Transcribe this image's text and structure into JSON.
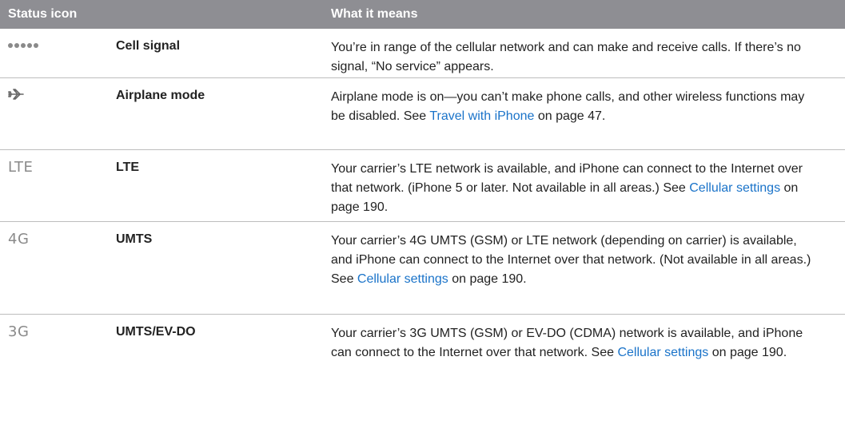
{
  "header": {
    "col1": "Status icon",
    "col2": "What it means"
  },
  "rows": [
    {
      "icon": "dots-signal-icon",
      "name": "Cell signal",
      "desc_pre": "You’re in range of the cellular network and can make and receive calls. If there’s no signal, “No service” appears.",
      "link": "",
      "desc_post": ""
    },
    {
      "icon": "airplane-icon",
      "name": "Airplane mode",
      "desc_pre": "Airplane mode is on—you can’t make phone calls, and other wireless functions may be disabled. See ",
      "link": "Travel with iPhone",
      "desc_post": " on page 47."
    },
    {
      "icon_text": "LTE",
      "name": "LTE",
      "desc_pre": "Your carrier’s LTE network is available, and iPhone can connect to the Internet over that network. (iPhone 5 or later. Not available in all areas.) See ",
      "link": "Cellular settings",
      "desc_post": " on page 190."
    },
    {
      "icon_text": "4G",
      "name": "UMTS",
      "desc_pre": "Your carrier’s 4G UMTS (GSM) or LTE network (depending on carrier) is available, and iPhone can connect to the Internet over that network. (Not available in all areas.) See ",
      "link": "Cellular settings",
      "desc_post": " on page 190."
    },
    {
      "icon_text": "3G",
      "name": "UMTS/EV-DO",
      "desc_pre": "Your carrier’s 3G UMTS (GSM) or EV-DO (CDMA) network is available, and iPhone can connect to the Internet over that network. See ",
      "link": "Cellular settings",
      "desc_post": " on page 190."
    }
  ],
  "colors": {
    "header_bg": "#8e8e93",
    "link": "#1a73c9",
    "divider": "#bdbdbd"
  }
}
